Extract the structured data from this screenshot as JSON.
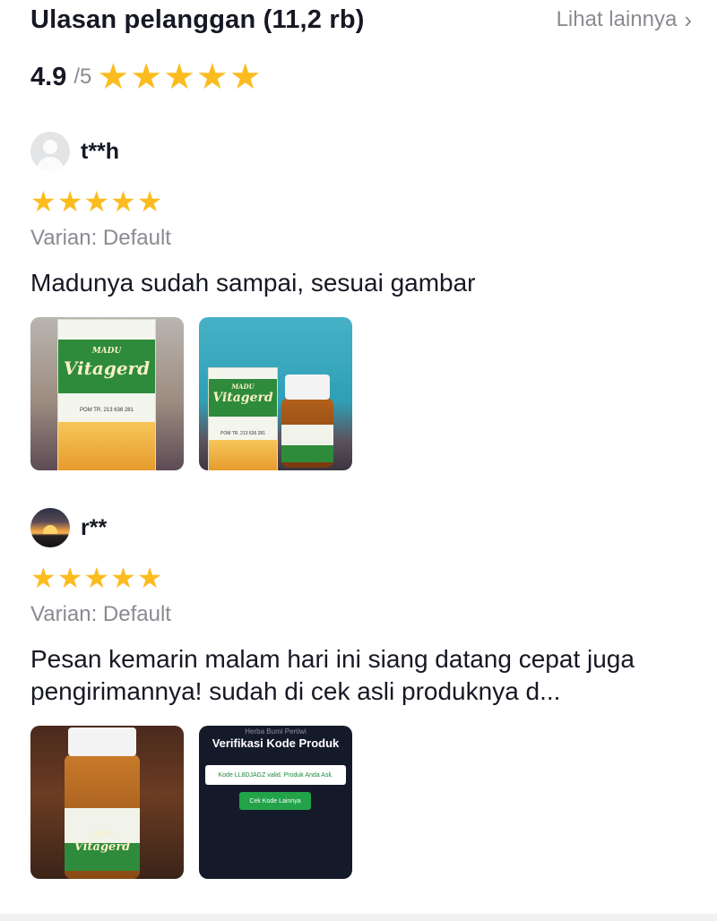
{
  "header": {
    "title": "Ulasan pelanggan (11,2 rb)",
    "see_more": "Lihat lainnya"
  },
  "summary": {
    "score": "4.9",
    "out_of": "/5",
    "stars": 5
  },
  "reviews": [
    {
      "username": "t**h",
      "avatar": "default-avatar-icon",
      "stars": 5,
      "variant": "Varian: Default",
      "text": "Madunya sudah sampai, sesuai gambar",
      "photos": [
        {
          "kind": "product-box",
          "brand": "Vitagerd",
          "sub": "MADU",
          "pom": "POM TR. 213 636 281"
        },
        {
          "kind": "box-and-jar",
          "brand": "Vitagerd",
          "sub": "MADU",
          "pom": "POM TR. 213 636 281"
        }
      ]
    },
    {
      "username": "r**",
      "avatar": "sunset-avatar",
      "stars": 5,
      "variant": "Varian: Default",
      "text": "Pesan kemarin malam hari ini siang datang cepat juga pengirimannya! sudah di cek asli produknya d...",
      "photos": [
        {
          "kind": "jar",
          "brand": "Vitagerd",
          "sub": "MADU"
        },
        {
          "kind": "verification-screenshot",
          "top_text": "Herba Bumi Pertiwi",
          "title": "Verifikasi Kode Produk",
          "message": "Kode LL8DJAGZ valid. Produk Anda Asli.",
          "button": "Cek Kode Lainnya"
        }
      ]
    }
  ],
  "colors": {
    "star": "#fcbc20",
    "muted_text": "#8a8b91",
    "text": "#161823"
  }
}
